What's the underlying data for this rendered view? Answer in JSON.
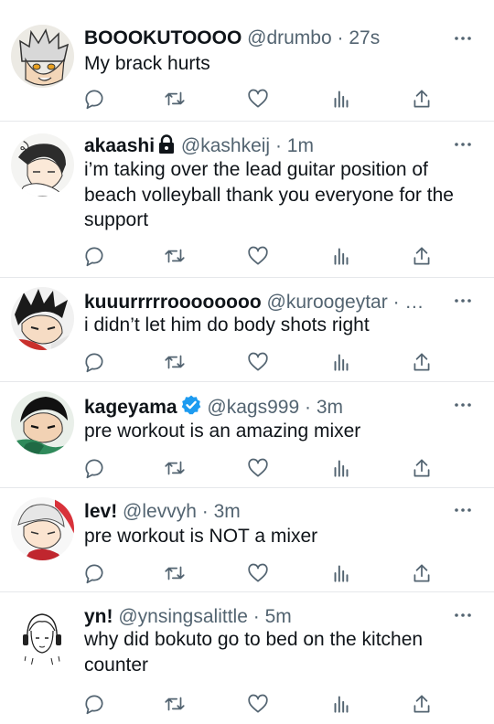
{
  "timeline": {
    "tweets": [
      {
        "name": "BOOOKUTOOOO",
        "handle": "@drumbo",
        "separator": "·",
        "time": "27s",
        "text": "My brack hurts",
        "avatar_icon": "anime-avatar-icon",
        "badge": ""
      },
      {
        "name": "akaashi",
        "handle": "@kashkeij",
        "separator": "·",
        "time": "1m",
        "text": "i’m taking over the lead guitar position of beach volleyball  thank  you everyone for the support",
        "avatar_icon": "anime-avatar-icon",
        "badge": "lock-icon"
      },
      {
        "name": "kuuurrrrroooooooo",
        "handle": "@kuroogeytar",
        "separator": "· …",
        "time": "",
        "text": "i didn’t let him do body shots right",
        "avatar_icon": "anime-avatar-icon",
        "badge": ""
      },
      {
        "name": "kageyama",
        "handle": "@kags999",
        "separator": "·",
        "time": "3m",
        "text": "pre workout is an amazing mixer",
        "avatar_icon": "anime-avatar-icon",
        "badge": "verified-icon"
      },
      {
        "name": "lev!",
        "handle": "@levvyh",
        "separator": "·",
        "time": "3m",
        "text": "pre workout is NOT a mixer",
        "avatar_icon": "anime-avatar-icon",
        "badge": ""
      },
      {
        "name": "yn!",
        "handle": "@ynsingsalittle",
        "separator": "·",
        "time": "5m",
        "text": "why did bokuto go to bed on the kitchen counter",
        "avatar_icon": "sketch-avatar-icon",
        "badge": ""
      }
    ],
    "action_icons": [
      "reply-icon",
      "retweet-icon",
      "like-icon",
      "analytics-icon",
      "share-icon"
    ],
    "colors": {
      "text": "#0f1419",
      "secondary": "#536471",
      "divider": "#e6e8eb",
      "verified": "#1d9bf0"
    }
  }
}
